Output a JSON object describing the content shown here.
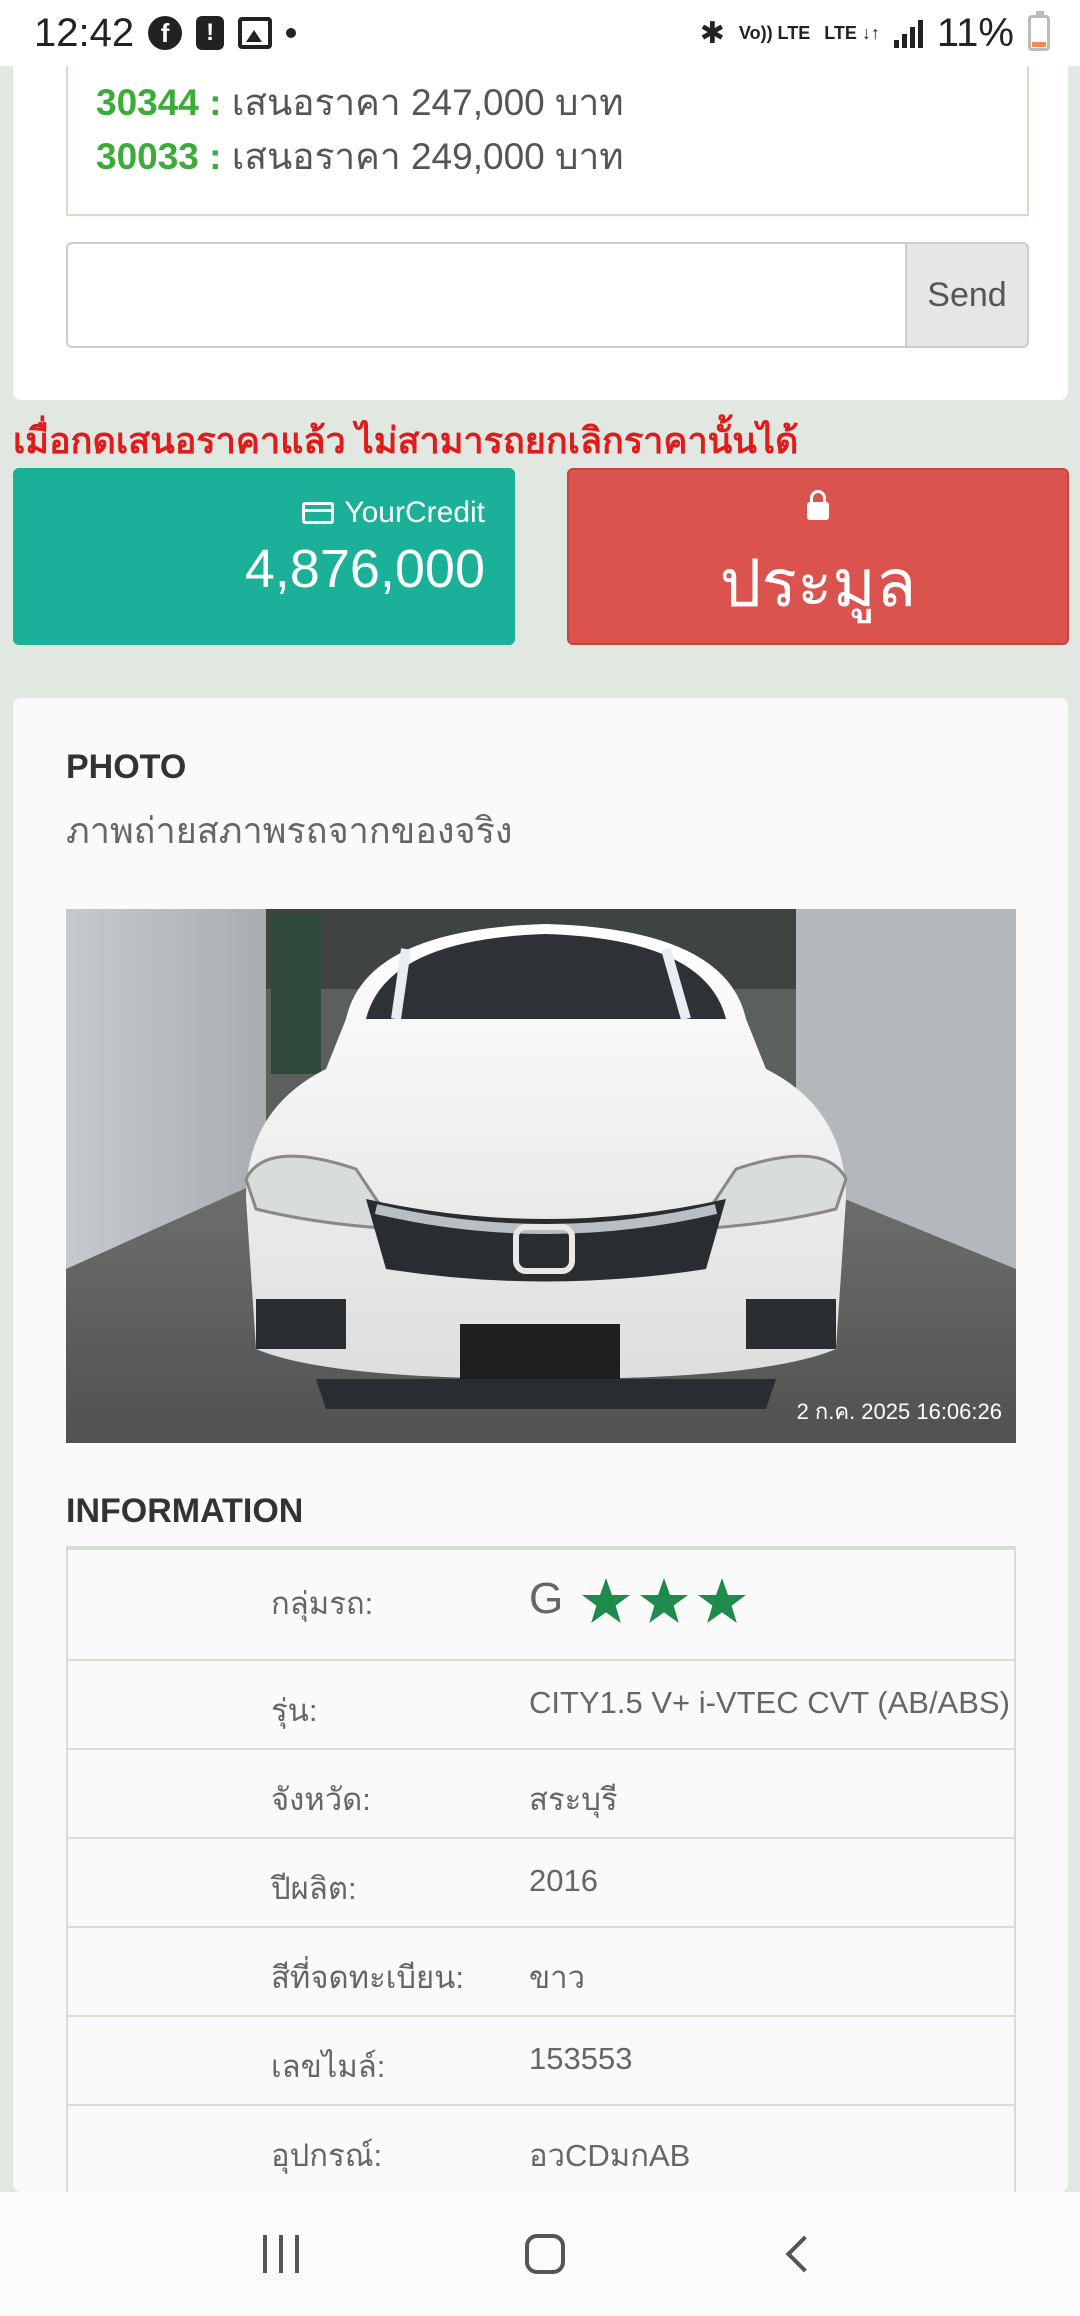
{
  "status_bar": {
    "time": "12:42",
    "volte": "Vo)) LTE",
    "lte": "LTE ↓↑",
    "battery": "11%"
  },
  "offers": [
    {
      "id": "30344 :",
      "text": " เสนอราคา 247,000 บาท"
    },
    {
      "id": "30033 :",
      "text": " เสนอราคา 249,000 บาท"
    }
  ],
  "message": {
    "value": "",
    "placeholder": "",
    "send_label": "Send"
  },
  "warning": "เมื่อกดเสนอราคาแล้ว ไม่สามารถยกเลิกราคานั้นได้",
  "credit": {
    "label": "YourCredit",
    "value": "4,876,000"
  },
  "bid_button": {
    "label": "ประมูล"
  },
  "photo_section": {
    "title": "PHOTO",
    "subtitle": "ภาพถ่ายสภาพรถจากของจริง",
    "timestamp": "2 ก.ค. 2025 16:06:26"
  },
  "information": {
    "title": "INFORMATION",
    "group": {
      "label": "กลุ่มรถ:",
      "grade": "G",
      "stars": 3
    },
    "rows": [
      {
        "label": "รุ่น:",
        "value": "CITY1.5 V+ i-VTEC CVT (AB/ABS)"
      },
      {
        "label": "จังหวัด:",
        "value": "สระบุรี"
      },
      {
        "label": "ปีผลิต:",
        "value": "2016"
      },
      {
        "label": "สีที่จดทะเบียน:",
        "value": "ขาว"
      },
      {
        "label": "เลขไมล์:",
        "value": "153553"
      },
      {
        "label": "อุปกรณ์:",
        "value": "อวCDมกAB"
      }
    ]
  },
  "colors": {
    "accent_green": "#3cab3a",
    "credit_bg": "#1bb199",
    "bid_bg": "#db534e",
    "warning": "#e01b1b",
    "star": "#1e8a4c"
  }
}
